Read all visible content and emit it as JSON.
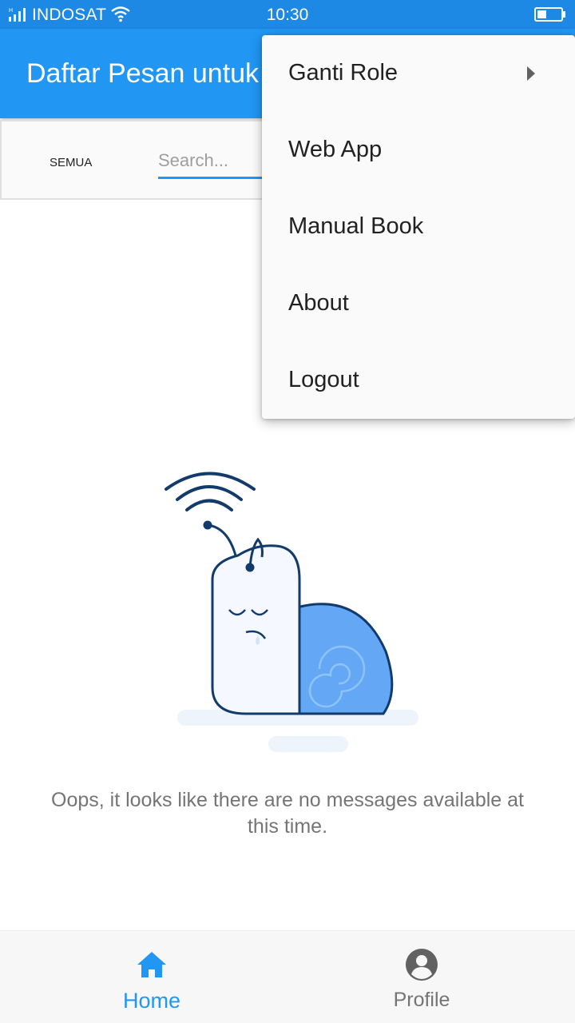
{
  "status_bar": {
    "carrier": "INDOSAT",
    "time": "10:30",
    "icons": [
      "signal-icon",
      "wifi-icon",
      "battery-icon"
    ]
  },
  "app_bar": {
    "title": "Daftar Pesan untuk"
  },
  "filter_bar": {
    "filter_label": "SEMUA",
    "search_placeholder": "Search..."
  },
  "empty_state": {
    "illustration": "sleepy-snail-illustration",
    "message": "Oops, it looks like there are no messages available at this time."
  },
  "overflow_menu": {
    "items": [
      {
        "label": "Ganti Role",
        "has_submenu": true
      },
      {
        "label": "Web App"
      },
      {
        "label": "Manual Book"
      },
      {
        "label": "About"
      },
      {
        "label": "Logout"
      }
    ]
  },
  "bottom_nav": {
    "items": [
      {
        "label": "Home",
        "icon": "home-icon",
        "active": true
      },
      {
        "label": "Profile",
        "icon": "account-circle-icon",
        "active": false
      }
    ]
  },
  "colors": {
    "status_bar": "#1e88e5",
    "primary": "#2196f3",
    "snail_shell": "#64a8f5",
    "snail_outline": "#123a6b",
    "text_secondary": "#757575"
  }
}
